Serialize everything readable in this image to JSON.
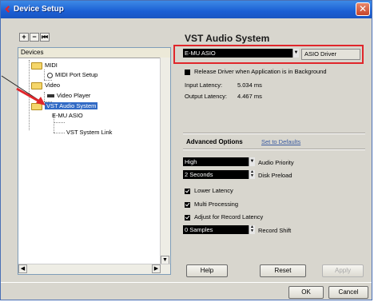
{
  "window": {
    "title": "Device Setup",
    "close_label": "✕"
  },
  "toolbar": {
    "add": "+",
    "remove": "−",
    "reset": "⏮"
  },
  "devices": {
    "header": "Devices",
    "items": [
      {
        "label": "MIDI",
        "type": "folder"
      },
      {
        "label": "MIDI Port Setup",
        "type": "midi-port"
      },
      {
        "label": "Video",
        "type": "folder"
      },
      {
        "label": "Video Player",
        "type": "video"
      },
      {
        "label": "VST Audio System",
        "type": "folder",
        "selected": true
      },
      {
        "label": "E-MU ASIO",
        "type": "device"
      },
      {
        "label": "VST System Link",
        "type": "device"
      }
    ]
  },
  "panel": {
    "title": "VST Audio System",
    "driver_value": "E-MU ASIO",
    "asio_driver_label": "ASIO Driver",
    "release_driver_label": "Release Driver when Application is in Background",
    "input_latency_label": "Input Latency:",
    "input_latency_value": "5.034 ms",
    "output_latency_label": "Output Latency:",
    "output_latency_value": "4.467 ms",
    "advanced_options_label": "Advanced Options",
    "set_to_defaults_label": "Set to Defaults",
    "audio_priority_value": "High",
    "audio_priority_label": "Audio Priority",
    "disk_preload_value": "2 Seconds",
    "disk_preload_label": "Disk Preload",
    "lower_latency_label": "Lower Latency",
    "multi_processing_label": "Multi Processing",
    "adjust_record_latency_label": "Adjust for Record Latency",
    "record_shift_value": "0 Samples",
    "record_shift_label": "Record Shift"
  },
  "buttons": {
    "help": "Help",
    "reset": "Reset",
    "apply": "Apply",
    "ok": "OK",
    "cancel": "Cancel"
  },
  "colors": {
    "highlight_box": "#e0262b",
    "selection": "#316ac5",
    "titlebar": "#1b5fd4"
  }
}
